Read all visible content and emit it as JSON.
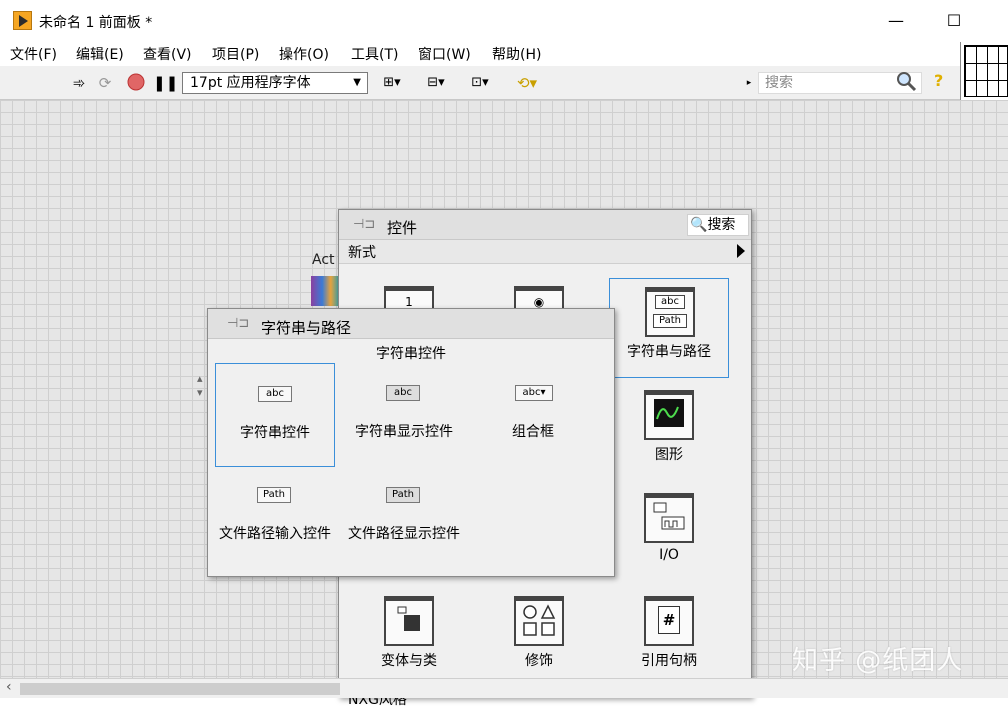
{
  "window": {
    "title": "未命名 1 前面板 *",
    "minimize": "—",
    "maximize": "☐"
  },
  "menu": [
    "文件(F)",
    "编辑(E)",
    "查看(V)",
    "项目(P)",
    "操作(O)",
    "工具(T)",
    "窗口(W)",
    "帮助(H)"
  ],
  "toolbar": {
    "font": "17pt 应用程序字体",
    "search_placeholder": "搜索",
    "help": "?"
  },
  "background": {
    "label": "Act"
  },
  "controls_palette": {
    "title": "控件",
    "search": "搜索",
    "subcategory": "新式",
    "items": [
      {
        "label": "",
        "icon": "numeric-icon"
      },
      {
        "label": "",
        "icon": "boolean-icon"
      },
      {
        "label": "字符串与路径",
        "icon": "string-path-icon",
        "selected": true
      },
      {
        "label": "图形",
        "icon": "graph-icon"
      },
      {
        "label": "I/O",
        "icon": "io-icon"
      },
      {
        "label": "变体与类",
        "icon": "variant-class-icon"
      },
      {
        "label": "修饰",
        "icon": "decorations-icon"
      },
      {
        "label": "引用句柄",
        "icon": "refnum-icon"
      }
    ],
    "footer": "NXG风格"
  },
  "string_palette": {
    "title": "字符串与路径",
    "heading": "字符串控件",
    "items": [
      {
        "label": "字符串控件",
        "glyph": "abc",
        "selected": true
      },
      {
        "label": "字符串显示控件",
        "glyph": "abc"
      },
      {
        "label": "组合框",
        "glyph": "abc"
      },
      {
        "label": "文件路径输入控件",
        "glyph": "Path"
      },
      {
        "label": "文件路径显示控件",
        "glyph": "Path"
      }
    ]
  },
  "watermark": "知乎 @纸团人"
}
